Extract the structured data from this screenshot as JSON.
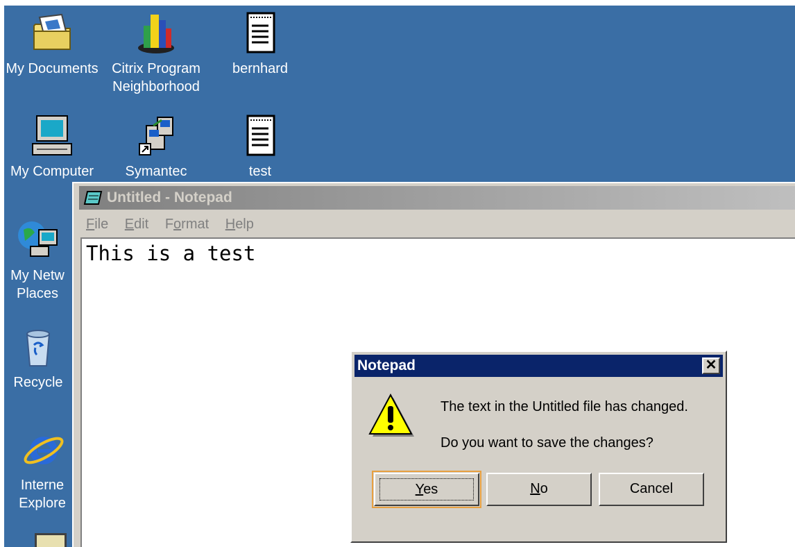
{
  "desktop": {
    "icons": [
      {
        "name": "My Documents",
        "icon": "folder-documents-icon"
      },
      {
        "name": "Citrix Program\nNeighborhood",
        "icon": "citrix-icon"
      },
      {
        "name": "bernhard",
        "icon": "text-file-icon"
      },
      {
        "name": "My Computer",
        "icon": "computer-icon"
      },
      {
        "name": "Symantec",
        "icon": "symantec-shortcut-icon"
      },
      {
        "name": "test",
        "icon": "text-file-icon"
      },
      {
        "name": "My Netw\nPlaces",
        "icon": "network-places-icon"
      },
      {
        "name": "Recycle",
        "icon": "recycle-bin-icon"
      },
      {
        "name": "Interne\nExplore",
        "icon": "internet-explorer-icon"
      }
    ]
  },
  "notepad": {
    "title": "Untitled - Notepad",
    "menu": [
      {
        "label": "File",
        "accel": "F",
        "rest": "ile"
      },
      {
        "label": "Edit",
        "accel": "E",
        "rest": "dit"
      },
      {
        "label": "Format",
        "accel_prefix": "F",
        "accel": "o",
        "rest": "rmat"
      },
      {
        "label": "Help",
        "accel": "H",
        "rest": "elp"
      }
    ],
    "content": "This is a test"
  },
  "dialog": {
    "title": "Notepad",
    "close_glyph": "✕",
    "message_line1": "The text in the Untitled file has changed.",
    "message_line2": "Do you want to save the changes?",
    "buttons": {
      "yes": {
        "accel": "Y",
        "rest": "es"
      },
      "no": {
        "accel": "N",
        "rest": "o"
      },
      "cancel": "Cancel"
    }
  },
  "colors": {
    "desktop": "#3a6ea5",
    "dialog_title": "#0a246a",
    "inactive_title": "#808080"
  }
}
